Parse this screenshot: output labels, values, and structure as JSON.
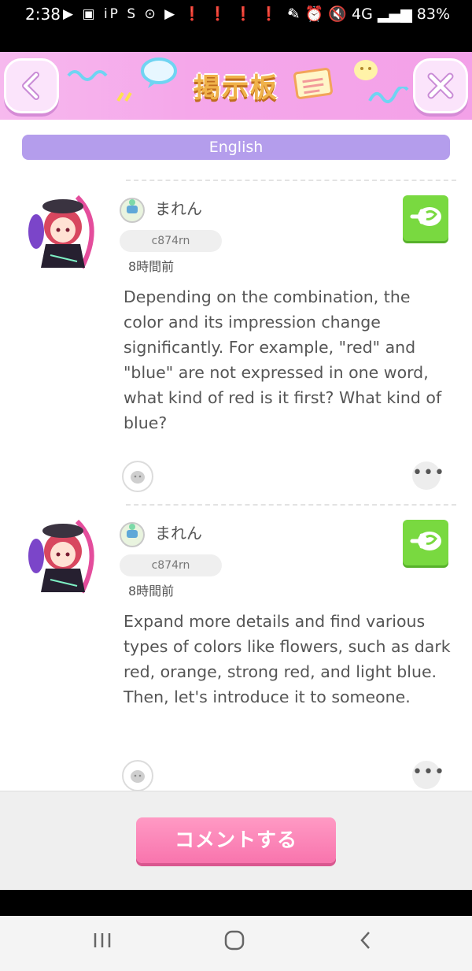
{
  "status_bar": {
    "time": "2:38",
    "icons": "▶ ▣ iP S ⊙ ▶ ❗ ❗ ❗ ❗ •",
    "right": "✎ ⏰ 🔇 4G ▂▄▆ 83%"
  },
  "header": {
    "title": "掲示板",
    "back_icon": "chevron-left-icon",
    "close_icon": "close-icon"
  },
  "language_bar": {
    "label": "English"
  },
  "posts": [
    {
      "username": "まれん",
      "user_id": "c874rn",
      "time_ago": "8時間前",
      "text": "Depending on the combination, the color and its impression change significantly. For example, \"red\" and \"blue\" are not expressed in one word, what kind of red is it first? What kind of blue?"
    },
    {
      "username": "まれん",
      "user_id": "c874rn",
      "time_ago": "8時間前",
      "text": "Expand more details and find various types of colors like flowers, such as dark red, orange, strong red, and light blue. Then, let's introduce it to someone."
    }
  ],
  "footer": {
    "comment_button": "コメントする"
  },
  "more_label": "•••",
  "colors": {
    "header_pink": "#f5a7ea",
    "language_bar": "#b49dec",
    "translate_green": "#79d940",
    "comment_pink": "#f874ad"
  }
}
